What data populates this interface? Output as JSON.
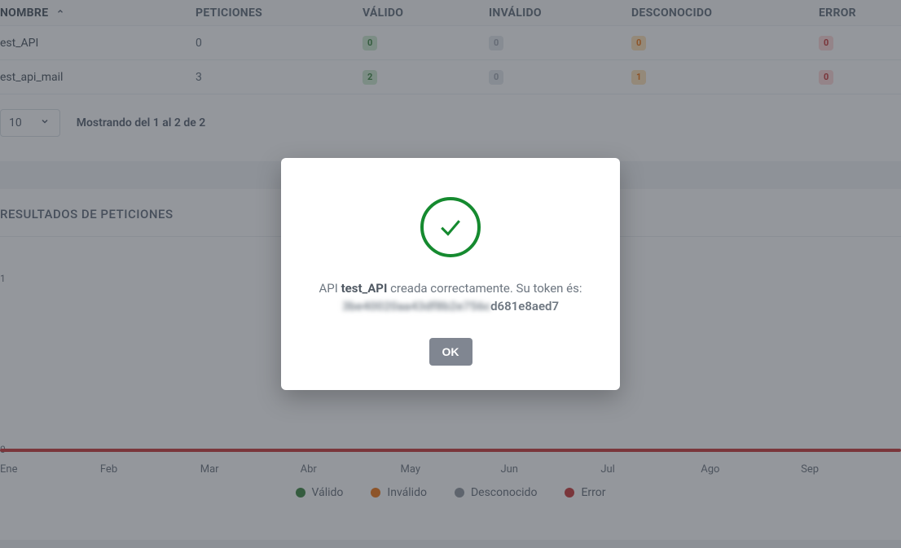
{
  "table": {
    "columns": {
      "nombre": "NOMBRE",
      "peticiones": "PETICIONES",
      "valido": "VÁLIDO",
      "invalido": "INVÁLIDO",
      "desconocido": "DESCONOCIDO",
      "error": "ERROR"
    },
    "rows": [
      {
        "nombre": "est_API",
        "peticiones": "0",
        "valido": "0",
        "invalido": "0",
        "desconocido": "0",
        "error": "0"
      },
      {
        "nombre": "est_api_mail",
        "peticiones": "3",
        "valido": "2",
        "invalido": "0",
        "desconocido": "1",
        "error": "0"
      }
    ]
  },
  "pager": {
    "size": "10",
    "text": "Mostrando del 1 al 2 de 2"
  },
  "section": {
    "title": "RESULTADOS DE PETICIONES"
  },
  "chart_data": {
    "type": "line",
    "categories": [
      "Ene",
      "Feb",
      "Mar",
      "Abr",
      "May",
      "Jun",
      "Jul",
      "Ago",
      "Sep"
    ],
    "series": [
      {
        "name": "Válido",
        "color": "#2e7d32",
        "values": [
          0,
          0,
          0,
          0,
          0,
          0,
          0,
          0,
          0
        ]
      },
      {
        "name": "Inválido",
        "color": "#ef6c00",
        "values": [
          0,
          0,
          0,
          0,
          0,
          0,
          0,
          0,
          0
        ]
      },
      {
        "name": "Desconocido",
        "color": "#888f97",
        "values": [
          0,
          0,
          0,
          0,
          0,
          0,
          0,
          0,
          0
        ]
      },
      {
        "name": "Error",
        "color": "#c62828",
        "values": [
          0,
          0,
          0,
          0,
          0,
          0,
          0,
          0,
          0
        ]
      }
    ],
    "ylim": [
      0,
      1
    ],
    "yticks": [
      "0",
      "1"
    ],
    "legend": {
      "valido": "Válido",
      "invalido": "Inválido",
      "desconocido": "Desconocido",
      "error": "Error"
    }
  },
  "modal": {
    "prefix": "API",
    "api_name": "test_API",
    "suffix": "creada correctamente. Su token és:",
    "token_hidden": "3be40020aa43df8b2e756c",
    "token_visible": "d681e8aed7",
    "ok": "OK"
  }
}
